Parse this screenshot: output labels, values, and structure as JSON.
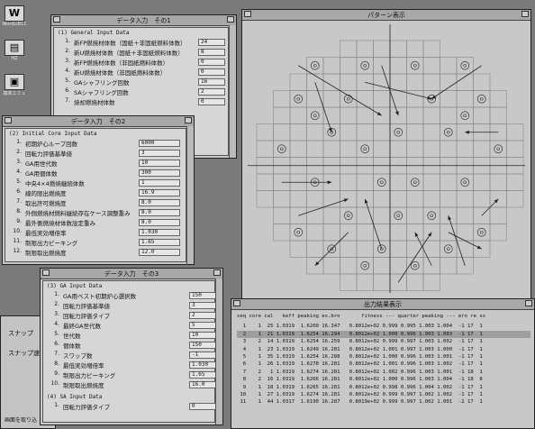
{
  "desktop": {
    "icons": [
      {
        "label": "WordLIB11",
        "glyph": "W",
        "icon": "word-app-icon"
      },
      {
        "label": "HZ",
        "glyph": "▤",
        "icon": "folder-icon"
      },
      {
        "label": "端末エミュ",
        "glyph": "▣",
        "icon": "terminal-icon"
      }
    ]
  },
  "win1": {
    "title": "データ入力　その1",
    "section": "(1)  General Input Data",
    "rows": [
      {
        "n": "1.",
        "label": "新FP燃焼材体数（固紙＋非固紙燃料体数）",
        "value": "24"
      },
      {
        "n": "2.",
        "label": "新U燃焼材体数（固紙＋非固紙燃料体数）",
        "value": "8"
      },
      {
        "n": "3.",
        "label": "新FP燃焼材体数（非固紙燃料体数）",
        "value": "0"
      },
      {
        "n": "4.",
        "label": "新U燃焼材体数（非固紙燃料体数）",
        "value": "0"
      },
      {
        "n": "5.",
        "label": "GAシャフリング回数",
        "value": "16"
      },
      {
        "n": "6.",
        "label": "SAシャフリング回数",
        "value": "2"
      },
      {
        "n": "7.",
        "label": "焼却燃焼材体数",
        "value": "0"
      }
    ]
  },
  "win2": {
    "title": "データ入力　その2",
    "section": "(2)  Initial Core Input Data",
    "rows": [
      {
        "n": "1.",
        "label": "初期炉心ループ回数",
        "value": "6000"
      },
      {
        "n": "2.",
        "label": "回転力評価基準値",
        "value": "3"
      },
      {
        "n": "3.",
        "label": "GA用世代数",
        "value": "10"
      },
      {
        "n": "4.",
        "label": "GA用個体数",
        "value": "300"
      },
      {
        "n": "5.",
        "label": "中央4×4燃焼継続体数",
        "value": "1"
      },
      {
        "n": "6.",
        "label": "線的限出燃焼度",
        "value": "16.9"
      },
      {
        "n": "7.",
        "label": "取出許可燃焼度",
        "value": "8.0"
      },
      {
        "n": "8.",
        "label": "外側燃焼材燃料継続存在ケース調整重み",
        "value": "8.0"
      },
      {
        "n": "9.",
        "label": "最外側燃焼材体数設定重み",
        "value": "8.0"
      },
      {
        "n": "10.",
        "label": "最低実効増倍率",
        "value": "1.030"
      },
      {
        "n": "11.",
        "label": "制限出力ピーキング",
        "value": "1.65"
      },
      {
        "n": "12.",
        "label": "制限取出燃焼度",
        "value": "12.0"
      }
    ]
  },
  "win3": {
    "title": "データ入力　その3",
    "section": "(3)  GA Input Data",
    "rows": [
      {
        "n": "1.",
        "label": "GA用ベスト初期炉心選択数",
        "value": "150"
      },
      {
        "n": "2.",
        "label": "回転力評価基準値",
        "value": "3"
      },
      {
        "n": "3.",
        "label": "回転力評価タイプ",
        "value": "2"
      },
      {
        "n": "4.",
        "label": "最終GA世代数",
        "value": "5"
      },
      {
        "n": "5.",
        "label": "世代数",
        "value": "10"
      },
      {
        "n": "6.",
        "label": "個体数",
        "value": "150"
      },
      {
        "n": "7.",
        "label": "スワップ数",
        "value": "-1"
      },
      {
        "n": "8.",
        "label": "最低実効増倍率",
        "value": "1.030"
      },
      {
        "n": "9.",
        "label": "制限出力ピーキング",
        "value": "1.65"
      },
      {
        "n": "10.",
        "label": "制限取出燃焼度",
        "value": "16.0"
      }
    ],
    "section2": "(4)  SA Input Data",
    "rows2": [
      {
        "n": "1.",
        "label": "回転力評価タイプ",
        "value": "0"
      }
    ]
  },
  "snap": {
    "label1": "スナップ",
    "label2": "スナップ速",
    "label3": "画面を取り込"
  },
  "pattern": {
    "title": "パターン表示"
  },
  "results": {
    "title": "出力結果表示",
    "header": "seq core cal   keff peaking ex.brn       fitness --- quarter peaking --- ern re ss",
    "selected_index": 1,
    "rows": [
      "  1    1  25 1.0319  1.6260 16.347   0.8012e+02 0.999 0.995 1.003 1.004  -1 17  1",
      "  2    1  21 1.0319  1.6254 16.294   0.8012e+02 1.000 0.996 1.003 1.003  -1 17  1",
      "  3    2  14 1.0319  1.6254 16.259   0.8012e+02 0.999 0.997 1.003 1.002  -1 17  1",
      "  4    1  23 1.0319  1.6249 16.281   0.8012e+02 1.001 0.997 1.003 1.000  -1 17  1",
      "  5    1  35 1.0319  1.6254 16.288   0.8012e+02 1.000 0.996 1.003 1.001  -1 17  1",
      "  6    1  26 1.0319  1.6278 16.281   0.8012e+02 1.001 0.996 1.003 1.002  -1 17  1",
      "  7    2   1 1.0319  1.6274 16.281   0.8012e+02 1.002 0.996 1.003 1.001  -1 18  1",
      "  8    2  16 1.0319  1.6266 16.281   0.8012e+02 1.000 0.996 1.003 1.004  -1 18  8",
      "  9    1  18 1.0319  1.6265 16.281   0.8012e+02 0.998 0.996 1.004 1.002  -1 17  1",
      " 10    1  27 1.0319  1.6274 16.281   0.8012e+02 0.999 0.997 1.002 1.002  -1 17  1",
      " 11    1  44 1.0317  1.6190 16.287   0.8019e+02 0.999 0.997 1.002 1.001  -2 17  1"
    ]
  }
}
